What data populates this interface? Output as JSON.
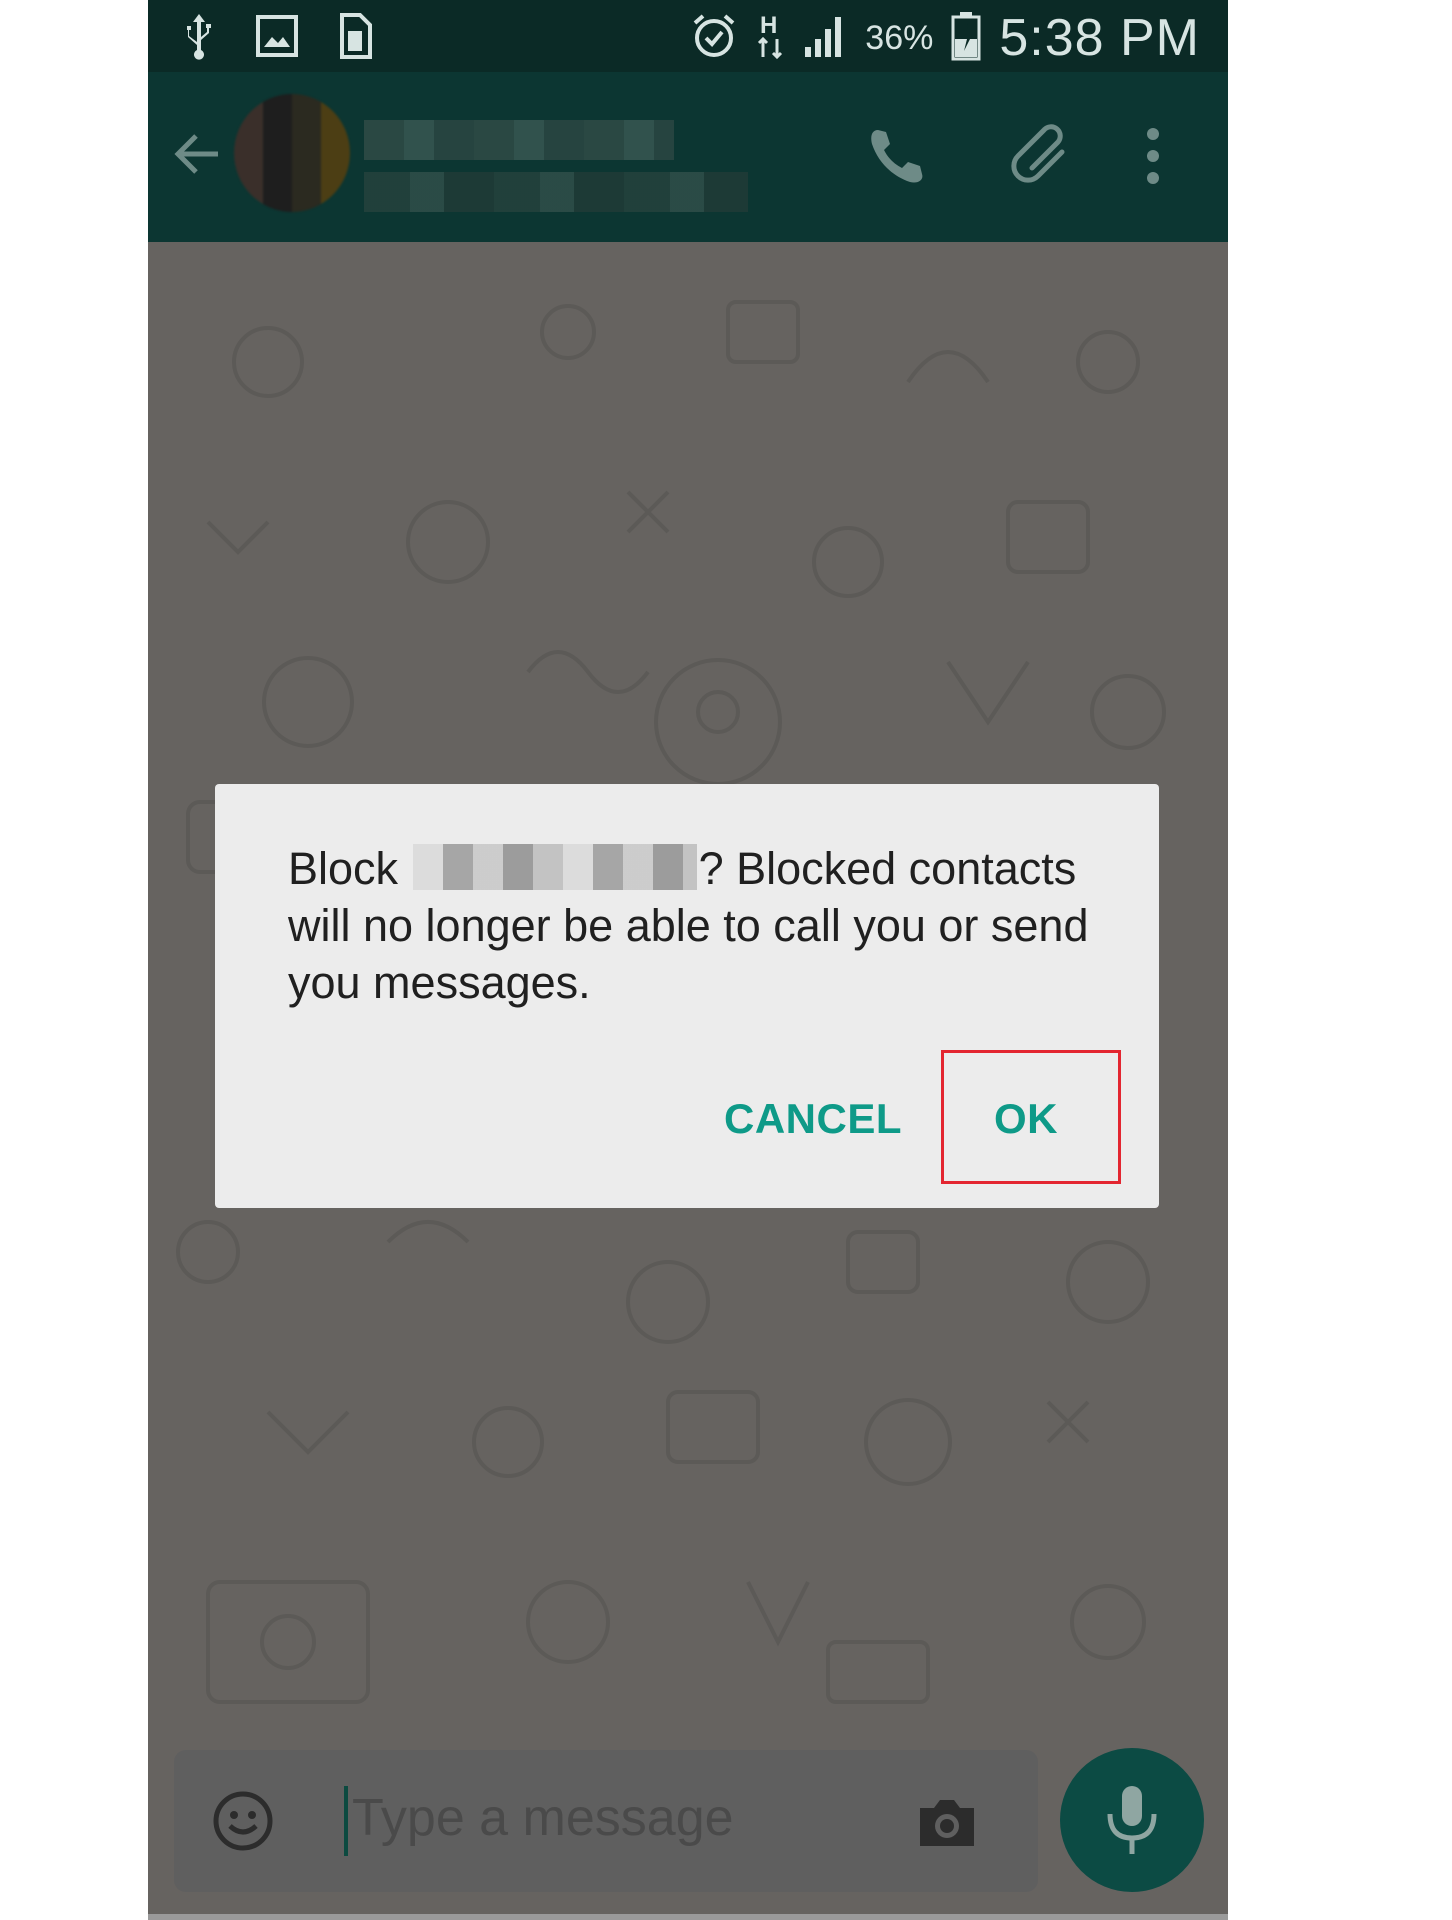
{
  "status_bar": {
    "battery_percent": "36%",
    "time": "5:38 PM",
    "network": "H",
    "icons": [
      "usb-icon",
      "image-notification-icon",
      "sim-icon",
      "alarm-icon",
      "data-transfer-icon",
      "signal-icon",
      "battery-charging-icon"
    ]
  },
  "toolbar": {
    "icons": [
      "back-arrow-icon",
      "phone-icon",
      "paperclip-icon",
      "overflow-menu-icon"
    ]
  },
  "dialog": {
    "message_prefix": "Block",
    "message_suffix": "? Blocked contacts will no longer be able to call you or send you messages.",
    "cancel_label": "CANCEL",
    "ok_label": "OK"
  },
  "composer": {
    "placeholder": "Type a message",
    "icons": [
      "emoji-icon",
      "camera-icon",
      "mic-icon"
    ]
  },
  "colors": {
    "status_bar": "#0b2a26",
    "toolbar": "#0c3632",
    "dialog_accent": "#0e9a88",
    "highlight_box": "#e32630",
    "mic_button": "#0c4b44"
  }
}
